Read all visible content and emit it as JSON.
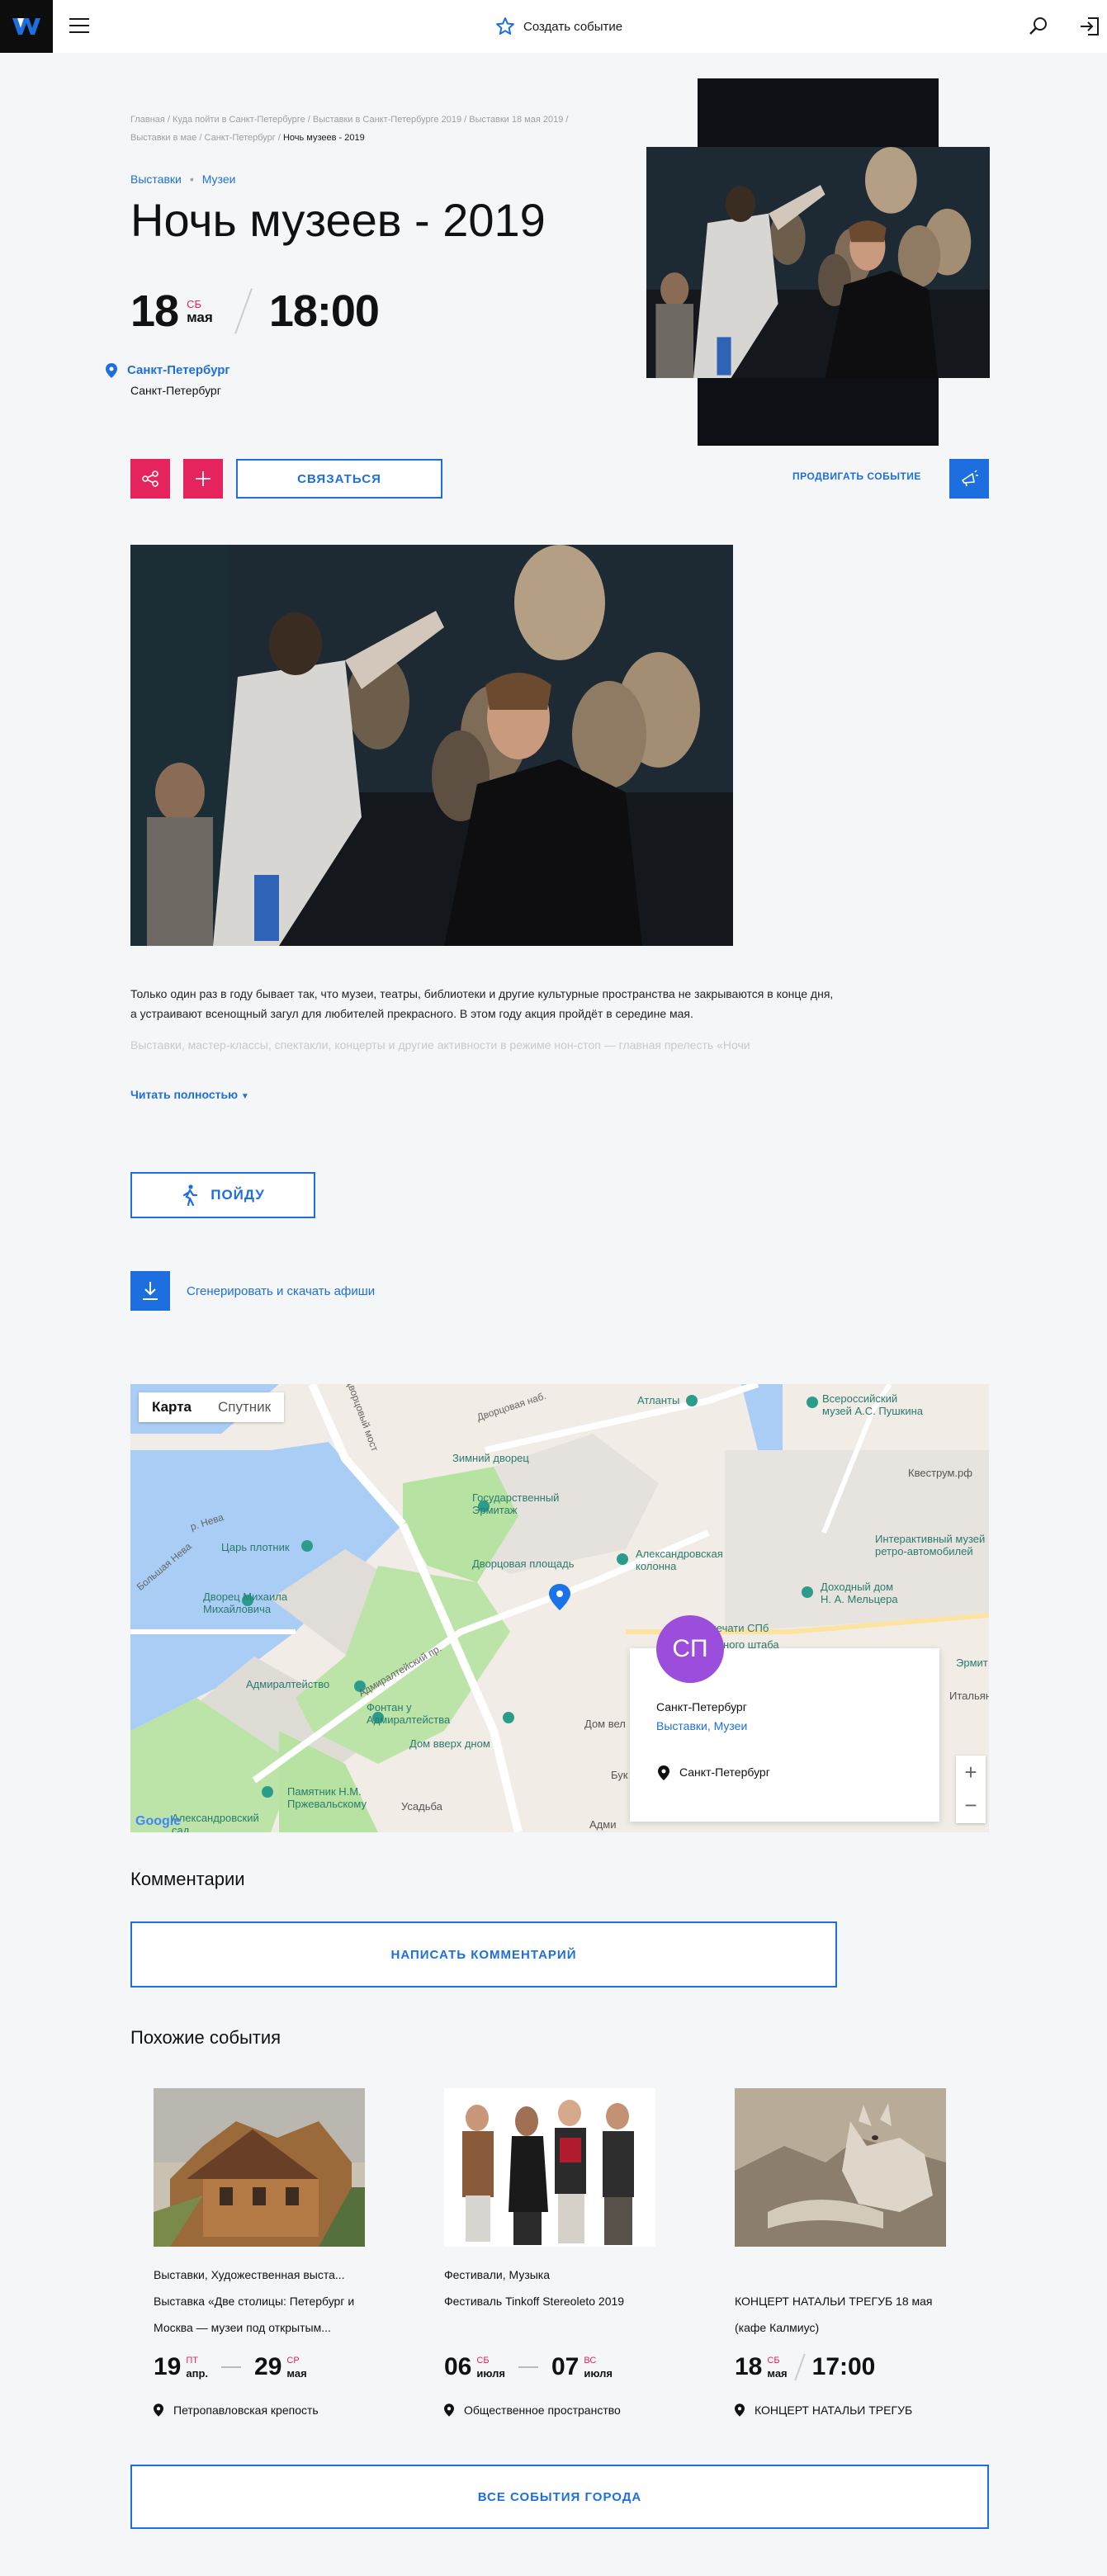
{
  "header": {
    "create_label": "Создать событие"
  },
  "breadcrumbs": {
    "items": [
      "Главная",
      "Куда пойти в Санкт-Петербурге",
      "Выставки в Санкт-Петербурге 2019",
      "Выставки 18 мая 2019",
      "Выставки в мае",
      "Санкт-Петербург"
    ],
    "sep": " / ",
    "current": "Ночь музеев - 2019"
  },
  "event": {
    "tags": [
      "Выставки",
      "Музеи"
    ],
    "title": "Ночь музеев - 2019",
    "day": "18",
    "weekday": "СБ",
    "month": "мая",
    "time": "18:00",
    "city": "Санкт-Петербург",
    "address": "Санкт-Петербург"
  },
  "actions": {
    "contact_label": "СВЯЗАТЬСЯ",
    "promote_label": "ПРОДВИГАТЬ СОБЫТИЕ",
    "go_label": "ПОЙДУ",
    "download_label": "Сгенерировать и скачать афиши"
  },
  "description": {
    "p1": "Только один раз в году бывает так, что музеи, театры, библиотеки и другие культурные пространства не закрываются в конце дня, а устраивают всенощный загул для любителей прекрасного. В этом году акция пройдёт в середине мая.",
    "p2": "Выставки, мастер-классы, спектакли, концерты и другие активности в режиме нон-стоп — главная прелесть «Ночи",
    "read_more": "Читать полностью"
  },
  "map": {
    "toggle_map": "Карта",
    "toggle_sat": "Спутник",
    "labels": {
      "atlanty": "Атланты",
      "pushkin": "Всероссийский\nмузей А.С. Пушкина",
      "zimniy": "Зимний дворец",
      "hermitage": "Государственный\nЭрмитаж",
      "kvestrum": "Квеструм.рф",
      "interactive": "Интерактивный музей\nретро-автомобилей",
      "tsar": "Царь плотник",
      "dvorts_pl": "Дворцовая площадь",
      "kolonna": "Александровская\nколонна",
      "mikhail": "Дворец Михаила\nМихайловича",
      "dom_pechati": "Дом печати СПб",
      "melzer": "Доходный дом\nН. А. Мельцера",
      "glavny": "Главного штаба",
      "admiral": "Адмиралтейство",
      "fontan": "Фонтан у\nАдмиралтейства",
      "dom_vverkh": "Дом вверх дном",
      "przhev": "Памятник Н.М.\nПржевальскому",
      "sad": "Александровский\nсад",
      "usadba": "Усадьба",
      "neva": "р. Нева",
      "neva2": "Большая Нева",
      "dvorts_most": "Дворцовый мост",
      "dvorts_nab": "Дворцовая наб.",
      "admir_pr": "Адмиралтейский пр.",
      "italian": "Итальянская",
      "google": "Google",
      "admi": "Адми",
      "bukh": "Бук",
      "dom_vel": "Дом вел",
      "ermit2": "Эрмит",
      "muzey_right": "Интерактивный муз"
    },
    "card_avatar": "СП",
    "card_title": "Санкт-Петербург",
    "card_tags": "Выставки, Музеи",
    "card_address": "Санкт-Петербург"
  },
  "comments": {
    "heading": "Комментарии",
    "button": "НАПИСАТЬ КОММЕНТАРИЙ"
  },
  "similar": {
    "heading": "Похожие события",
    "items": [
      {
        "category": "Выставки, Художественная выста...",
        "name": "Выставка «Две столицы: Петербург и Москва — музеи под открытым...",
        "d1": "19",
        "w1": "ПТ",
        "m1": "апр.",
        "d2": "29",
        "w2": "СР",
        "m2": "мая",
        "place": "Петропавловская крепость"
      },
      {
        "category": "Фестивали, Музыка",
        "name": "Фестиваль Tinkoff Stereoleto 2019",
        "d1": "06",
        "w1": "СБ",
        "m1": "июля",
        "d2": "07",
        "w2": "ВС",
        "m2": "июля",
        "place": "Общественное пространство"
      },
      {
        "category": "",
        "name": "КОНЦЕРТ НАТАЛЬИ ТРЕГУБ 18 мая (кафе Калмиус)",
        "d1": "18",
        "w1": "СБ",
        "m1": "мая",
        "time": "17:00",
        "place": "КОНЦЕРТ НАТАЛЬИ ТРЕГУБ"
      }
    ],
    "all_button": "ВСЕ СОБЫТИЯ ГОРОДА"
  },
  "colors": {
    "accent": "#1d6fe0",
    "pink": "#e5245e",
    "avatar": "#9b4ddb"
  }
}
